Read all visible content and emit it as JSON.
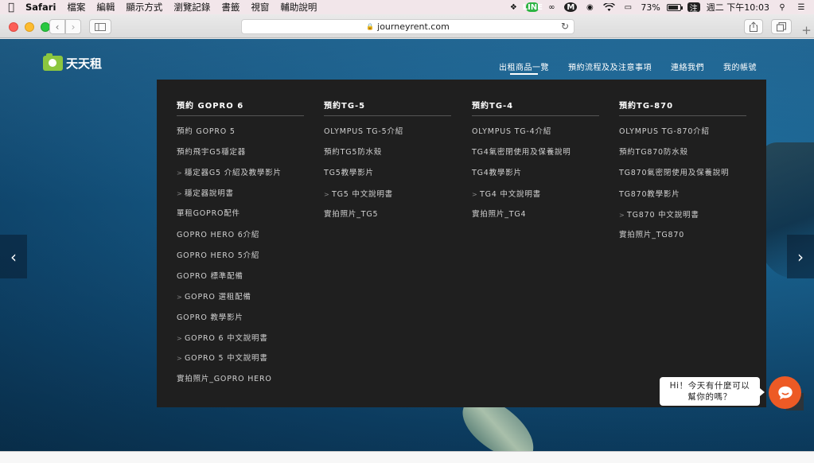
{
  "menubar": {
    "app": "Safari",
    "items": [
      "檔案",
      "編輯",
      "顯示方式",
      "瀏覽記錄",
      "書籤",
      "視窗",
      "輔助說明"
    ],
    "line_badge": "LINE",
    "m_badge": "M",
    "battery_text": "73%",
    "battery_level": 0.73,
    "ime": "注",
    "datetime": "週二 下午10:03"
  },
  "toolbar": {
    "url": "journeyrent.com"
  },
  "site": {
    "logo_text": "天天租",
    "nav": [
      "出租商品一覽",
      "預約流程及及注意事項",
      "連絡我們",
      "我的帳號"
    ]
  },
  "mega_menu": {
    "columns": [
      {
        "heading": "預約 GOPRO 6",
        "items": [
          {
            "label": "預約 GOPRO 5",
            "sub": false
          },
          {
            "label": "預約飛宇G5穩定器",
            "sub": false
          },
          {
            "label": "穩定器G5 介紹及教學影片",
            "sub": true
          },
          {
            "label": "穩定器說明書",
            "sub": true
          },
          {
            "label": "單租GOPRO配件",
            "sub": false
          },
          {
            "label": "GOPRO HERO 6介紹",
            "sub": false
          },
          {
            "label": "GOPRO HERO 5介紹",
            "sub": false
          },
          {
            "label": "GOPRO 標準配備",
            "sub": false
          },
          {
            "label": "GOPRO 選租配備",
            "sub": true
          },
          {
            "label": "GOPRO 教學影片",
            "sub": false
          },
          {
            "label": "GOPRO 6 中文說明書",
            "sub": true
          },
          {
            "label": "GOPRO 5 中文說明書",
            "sub": true
          },
          {
            "label": "實拍照片_GOPRO HERO",
            "sub": false
          }
        ]
      },
      {
        "heading": "預約TG-5",
        "items": [
          {
            "label": "OLYMPUS TG-5介紹",
            "sub": false
          },
          {
            "label": "預約TG5防水殼",
            "sub": false
          },
          {
            "label": "TG5教學影片",
            "sub": false
          },
          {
            "label": "TG5 中文說明書",
            "sub": true
          },
          {
            "label": "實拍照片_TG5",
            "sub": false
          }
        ]
      },
      {
        "heading": "預約TG-4",
        "items": [
          {
            "label": "OLYMPUS TG-4介紹",
            "sub": false
          },
          {
            "label": "TG4氣密閉使用及保養說明",
            "sub": false
          },
          {
            "label": "TG4教學影片",
            "sub": false
          },
          {
            "label": "TG4 中文說明書",
            "sub": true
          },
          {
            "label": "實拍照片_TG4",
            "sub": false
          }
        ]
      },
      {
        "heading": "預約TG-870",
        "items": [
          {
            "label": "OLYMPUS TG-870介紹",
            "sub": false
          },
          {
            "label": "預約TG870防水殼",
            "sub": false
          },
          {
            "label": "TG870氣密閉使用及保養說明",
            "sub": false
          },
          {
            "label": "TG870教學影片",
            "sub": false
          },
          {
            "label": "TG870 中文說明書",
            "sub": true
          },
          {
            "label": "實拍照片_TG870",
            "sub": false
          }
        ]
      }
    ]
  },
  "chat": {
    "line1": "Hi！今天有什麼可以",
    "line2": "幫你的嗎？"
  },
  "colors": {
    "accent_orange": "#ed5a25",
    "logo_green": "#8cc63f",
    "menu_bg": "#1f1f1f"
  }
}
